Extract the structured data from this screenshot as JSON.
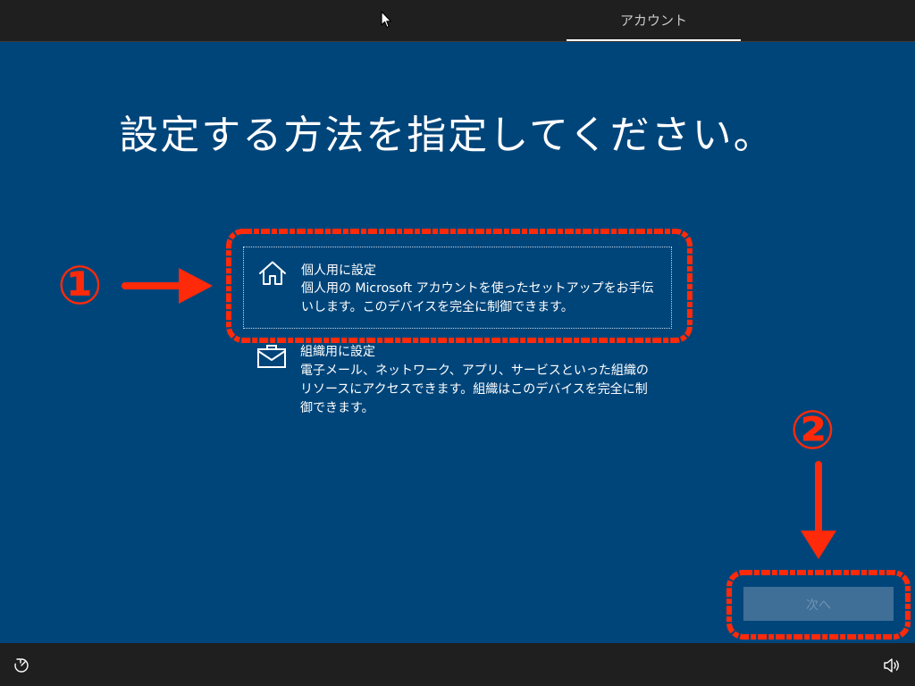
{
  "header": {
    "tab_label": "アカウント"
  },
  "main": {
    "title": "設定する方法を指定してください。",
    "options": [
      {
        "title": "個人用に設定",
        "description": "個人用の Microsoft アカウントを使ったセットアップをお手伝いします。このデバイスを完全に制御できます。",
        "icon": "home-icon",
        "selected": true
      },
      {
        "title": "組織用に設定",
        "description": "電子メール、ネットワーク、アプリ、サービスといった組織のリソースにアクセスできます。組織はこのデバイスを完全に制御できます。",
        "icon": "briefcase-icon",
        "selected": false
      }
    ],
    "next_label": "次へ"
  },
  "annotations": {
    "step1": "①",
    "step2": "②"
  },
  "footer": {
    "left_icon": "ease-of-access-icon",
    "right_icon": "volume-icon"
  },
  "colors": {
    "background": "#00457a",
    "bar": "#1f1f1f",
    "annotation": "#ff2a0a",
    "next_button": "#3f6e96"
  }
}
